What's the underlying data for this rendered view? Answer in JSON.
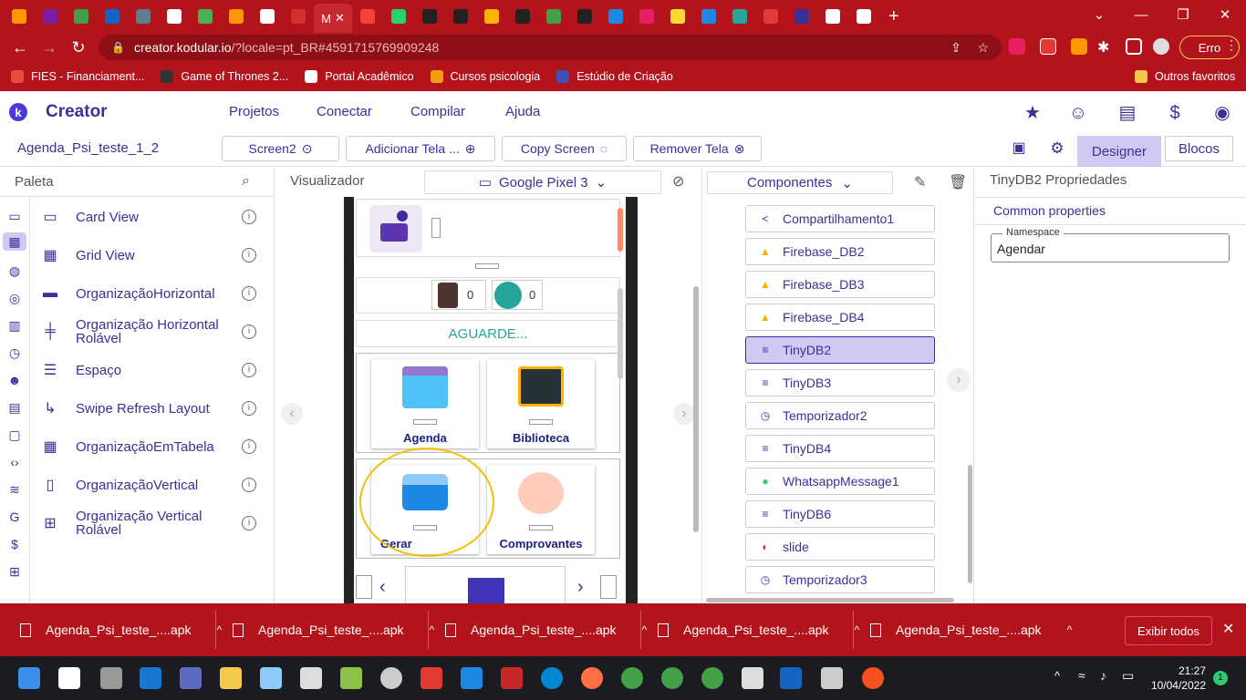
{
  "browser": {
    "tabs_count": 30,
    "active_tab_label": "M",
    "url_host": "creator.kodular.io",
    "url_rest": "/?locale=pt_BR#4591715769909248",
    "error_button": "Erro",
    "bookmarks": [
      {
        "label": "FIES - Financiament...",
        "color": "#e74c3c"
      },
      {
        "label": "Game of Thrones 2...",
        "color": "#333333"
      },
      {
        "label": "Portal Acadêmico",
        "color": "#ffffff"
      },
      {
        "label": "Cursos psicologia",
        "color": "#f39c12"
      },
      {
        "label": "Estúdio de Criação",
        "color": "#3f51b5"
      }
    ],
    "other_bookmarks": "Outros favoritos"
  },
  "kodular": {
    "brand": "Creator",
    "logo_letter": "k",
    "menu": [
      "Projetos",
      "Conectar",
      "Compilar",
      "Ajuda"
    ],
    "project_name": "Agenda_Psi_teste_1_2",
    "screen_button": "Screen2",
    "add_screen": "Adicionar Tela ...",
    "copy_screen": "Copy Screen",
    "remove_screen": "Remover Tela",
    "designer": "Designer",
    "blocks": "Blocos"
  },
  "palette": {
    "title": "Paleta",
    "items": [
      {
        "label": "Card View"
      },
      {
        "label": "Grid View"
      },
      {
        "label": "OrganizaçãoHorizontal"
      },
      {
        "label": "Organização Horizontal Rolável"
      },
      {
        "label": "Espaço"
      },
      {
        "label": "Swipe Refresh Layout"
      },
      {
        "label": "OrganizaçãoEmTabela"
      },
      {
        "label": "OrganizaçãoVertical"
      },
      {
        "label": "Organização Vertical Rolável"
      }
    ]
  },
  "viewer": {
    "title": "Visualizador",
    "device": "Google Pixel 3",
    "counter_a": "0",
    "counter_b": "0",
    "waiting": "AGUARDE...",
    "cards": [
      "Agenda",
      "Biblioteca",
      "Gerar",
      "Comprovantes"
    ]
  },
  "components": {
    "selector": "Componentes",
    "items": [
      {
        "label": "Compartilhamento1",
        "icon": "share-icon",
        "color": "#3b2f98"
      },
      {
        "label": "Firebase_DB2",
        "icon": "firebase-icon",
        "color": "#f5b300"
      },
      {
        "label": "Firebase_DB3",
        "icon": "firebase-icon",
        "color": "#f5b300"
      },
      {
        "label": "Firebase_DB4",
        "icon": "firebase-icon",
        "color": "#f5b300"
      },
      {
        "label": "TinyDB2",
        "icon": "database-icon",
        "color": "#3b2f98",
        "selected": true
      },
      {
        "label": "TinyDB3",
        "icon": "database-icon",
        "color": "#3b2f98"
      },
      {
        "label": "Temporizador2",
        "icon": "timer-icon",
        "color": "#3b2f98"
      },
      {
        "label": "TinyDB4",
        "icon": "database-icon",
        "color": "#3b2f98"
      },
      {
        "label": "WhatsappMessage1",
        "icon": "whatsapp-icon",
        "color": "#25d366"
      },
      {
        "label": "TinyDB6",
        "icon": "database-icon",
        "color": "#3b2f98"
      },
      {
        "label": "slide",
        "icon": "slide-icon",
        "color": "#e91e63"
      },
      {
        "label": "Temporizador3",
        "icon": "timer-icon",
        "color": "#3b2f98"
      }
    ]
  },
  "properties": {
    "title": "TinyDB2 Propriedades",
    "section": "Common properties",
    "namespace_label": "Namespace",
    "namespace_value": "Agendar"
  },
  "downloads": {
    "files": [
      "Agenda_Psi_teste_....apk",
      "Agenda_Psi_teste_....apk",
      "Agenda_Psi_teste_....apk",
      "Agenda_Psi_teste_....apk",
      "Agenda_Psi_teste_....apk"
    ],
    "show_all": "Exibir todos"
  },
  "taskbar": {
    "time": "21:27",
    "date": "10/04/2022",
    "notifications": "1"
  },
  "colors": {
    "accent": "#3b2f98",
    "chrome": "#b3141c",
    "selected": "#cfc9f3",
    "highlight_circle": "#f2c200"
  }
}
